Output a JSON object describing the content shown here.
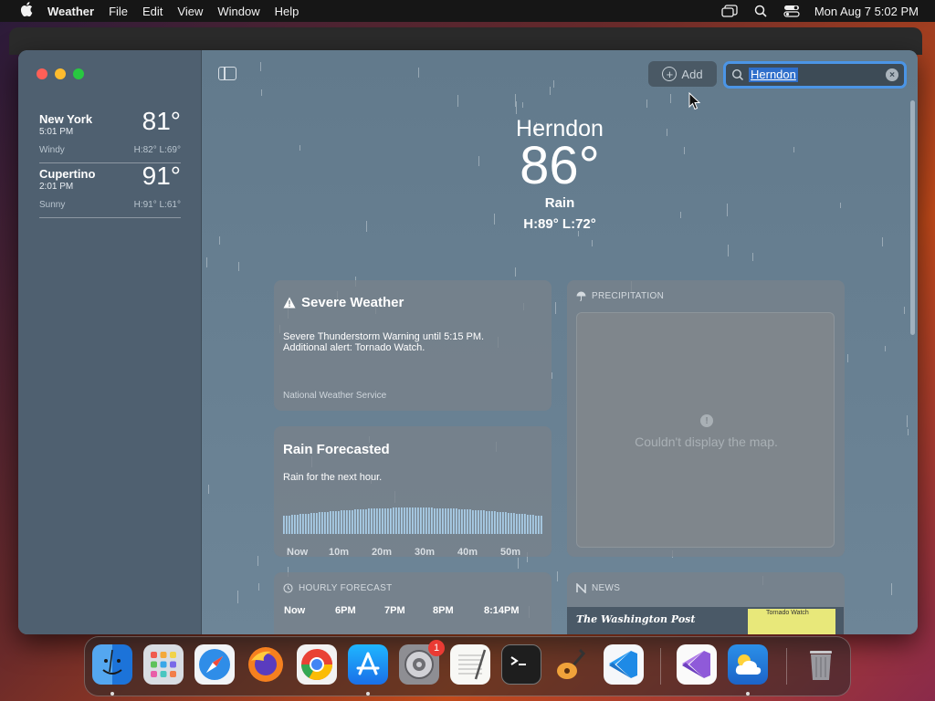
{
  "menubar": {
    "app_name": "Weather",
    "menus": [
      "File",
      "Edit",
      "View",
      "Window",
      "Help"
    ],
    "clock": "Mon Aug 7  5:02 PM"
  },
  "toolbar": {
    "add_label": "Add",
    "search_value": "Herndon"
  },
  "sidebar": {
    "cities": [
      {
        "name": "New York",
        "time": "5:01 PM",
        "temp": "81°",
        "condition": "Windy",
        "hl": "H:82°  L:69°"
      },
      {
        "name": "Cupertino",
        "time": "2:01 PM",
        "temp": "91°",
        "condition": "Sunny",
        "hl": "H:91°  L:61°"
      }
    ]
  },
  "current": {
    "location": "Herndon",
    "temperature": "86°",
    "condition": "Rain",
    "high_low": "H:89°  L:72°"
  },
  "severe": {
    "title": "Severe Weather",
    "line1": "Severe Thunderstorm Warning until 5:15 PM.",
    "line2": "Additional alert: Tornado Watch.",
    "source": "National Weather Service"
  },
  "rain": {
    "title": "Rain Forecasted",
    "subtitle": "Rain for the next hour.",
    "axis": [
      "Now",
      "10m",
      "20m",
      "30m",
      "40m",
      "50m"
    ]
  },
  "precipitation": {
    "title": "PRECIPITATION",
    "message": "Couldn't display the map."
  },
  "hourly": {
    "title": "HOURLY FORECAST",
    "hours": [
      "Now",
      "6PM",
      "7PM",
      "8PM",
      "8:14PM"
    ]
  },
  "news": {
    "title": "NEWS",
    "publisher": "The Washington Post",
    "thumb_caption": "Tornado Watch"
  },
  "dock": {
    "badge_count": "1",
    "apps": [
      "Finder",
      "Launchpad",
      "Safari",
      "Firefox",
      "Chrome",
      "App Store",
      "System Settings",
      "TextEdit",
      "Terminal",
      "GarageBand",
      "Visual Studio Code",
      "Visual Studio",
      "Weather",
      "Trash"
    ]
  },
  "colors": {
    "search_focus": "#4b95e6",
    "rain_bars": "#a8cce6",
    "badge": "#ea3b34"
  }
}
